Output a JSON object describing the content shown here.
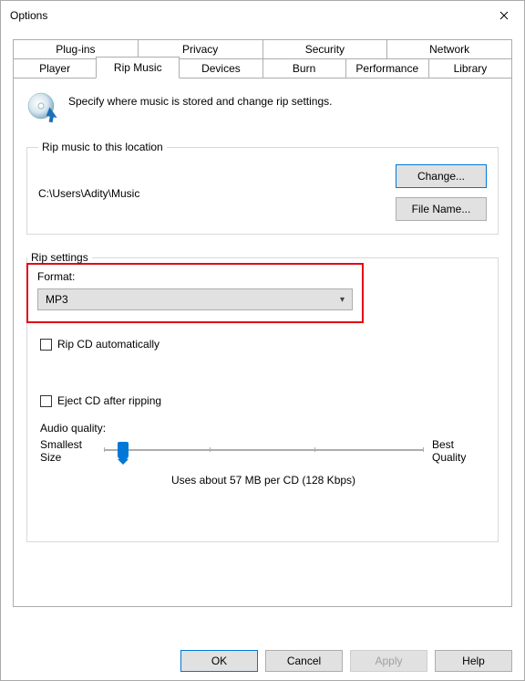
{
  "window": {
    "title": "Options"
  },
  "tabs_row1": [
    {
      "label": "Plug-ins"
    },
    {
      "label": "Privacy"
    },
    {
      "label": "Security"
    },
    {
      "label": "Network"
    }
  ],
  "tabs_row2": [
    {
      "label": "Player"
    },
    {
      "label": "Rip Music",
      "active": true
    },
    {
      "label": "Devices"
    },
    {
      "label": "Burn"
    },
    {
      "label": "Performance"
    },
    {
      "label": "Library"
    }
  ],
  "header": {
    "description": "Specify where music is stored and change rip settings."
  },
  "rip_location": {
    "legend": "Rip music to this location",
    "path": "C:\\Users\\Adity\\Music",
    "change_btn": "Change...",
    "filename_btn": "File Name..."
  },
  "rip_settings": {
    "legend": "Rip settings",
    "format_label": "Format:",
    "format_value": "MP3",
    "rip_auto_label": "Rip CD automatically",
    "rip_auto_checked": false,
    "eject_label": "Eject CD after ripping",
    "eject_checked": false,
    "audio_quality_label": "Audio quality:",
    "slider_left": "Smallest\nSize",
    "slider_right": "Best\nQuality",
    "slider_pos_pct": 6,
    "usage_text": "Uses about 57 MB per CD (128 Kbps)"
  },
  "footer": {
    "ok": "OK",
    "cancel": "Cancel",
    "apply": "Apply",
    "help": "Help"
  }
}
